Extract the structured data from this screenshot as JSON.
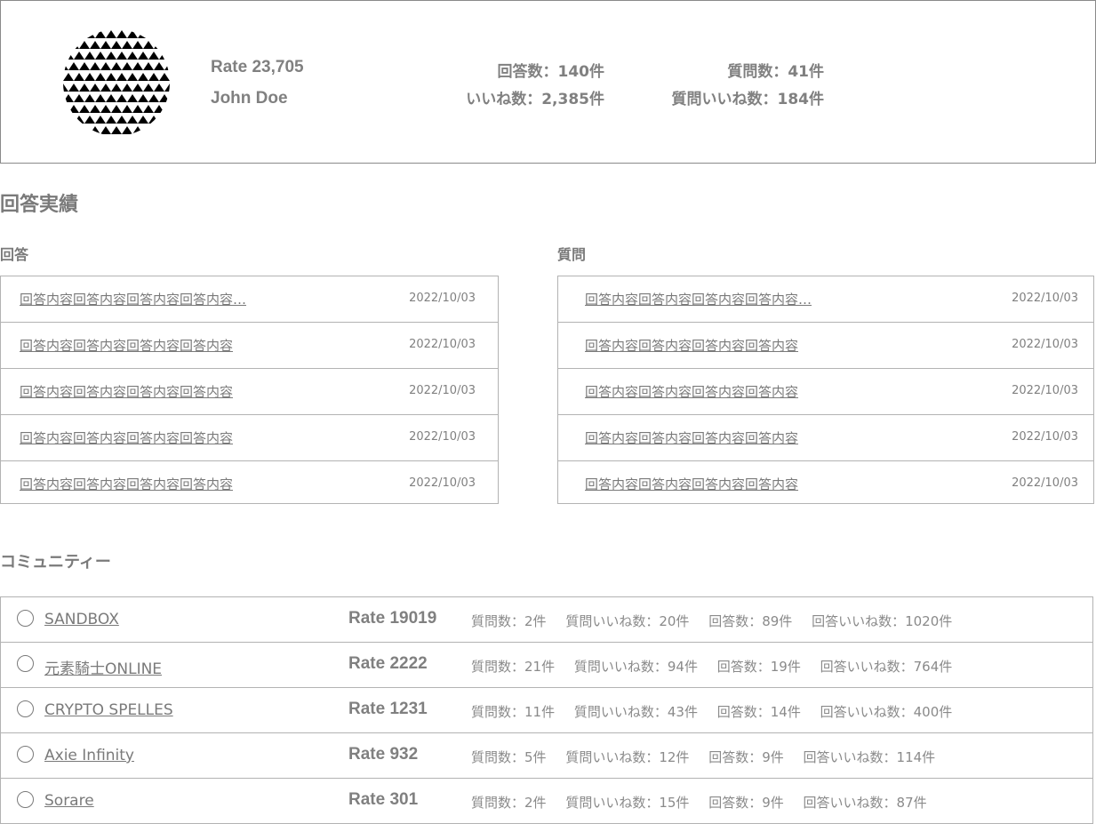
{
  "profile": {
    "rate_label": "Rate 23,705",
    "name": "John Doe",
    "stats": {
      "answer_count": "回答数：140件",
      "question_count": "質問数：41件",
      "like_count": "いいね数：2,385件",
      "question_like_count": "質問いいね数：184件"
    }
  },
  "achievements": {
    "title": "回答実績",
    "answers": {
      "heading": "回答",
      "items": [
        {
          "text": "回答内容回答内容回答内容回答内容…",
          "date": "2022/10/03"
        },
        {
          "text": "回答内容回答内容回答内容回答内容",
          "date": "2022/10/03"
        },
        {
          "text": "回答内容回答内容回答内容回答内容",
          "date": "2022/10/03"
        },
        {
          "text": "回答内容回答内容回答内容回答内容",
          "date": "2022/10/03"
        },
        {
          "text": "回答内容回答内容回答内容回答内容",
          "date": "2022/10/03"
        }
      ]
    },
    "questions": {
      "heading": "質問",
      "items": [
        {
          "text": "回答内容回答内容回答内容回答内容…",
          "date": "2022/10/03"
        },
        {
          "text": "回答内容回答内容回答内容回答内容",
          "date": "2022/10/03"
        },
        {
          "text": "回答内容回答内容回答内容回答内容",
          "date": "2022/10/03"
        },
        {
          "text": "回答内容回答内容回答内容回答内容",
          "date": "2022/10/03"
        },
        {
          "text": "回答内容回答内容回答内容回答内容",
          "date": "2022/10/03"
        }
      ]
    }
  },
  "community": {
    "title": "コミュニティー",
    "items": [
      {
        "name": "SANDBOX",
        "rate": "Rate 19019",
        "questions": "質問数：2件",
        "question_likes": "質問いいね数：20件",
        "answers": "回答数：89件",
        "answer_likes": "回答いいね数：1020件"
      },
      {
        "name": "元素騎士ONLINE",
        "rate": "Rate 2222",
        "questions": "質問数：21件",
        "question_likes": "質問いいね数：94件",
        "answers": "回答数：19件",
        "answer_likes": "回答いいね数：764件"
      },
      {
        "name": "CRYPTO SPELLES",
        "rate": "Rate 1231",
        "questions": "質問数：11件",
        "question_likes": "質問いいね数：43件",
        "answers": "回答数：14件",
        "answer_likes": "回答いいね数：400件"
      },
      {
        "name": "Axie Infinity",
        "rate": "Rate 932",
        "questions": "質問数：5件",
        "question_likes": "質問いいね数：12件",
        "answers": "回答数：9件",
        "answer_likes": "回答いいね数：114件"
      },
      {
        "name": "Sorare",
        "rate": "Rate 301",
        "questions": "質問数：2件",
        "question_likes": "質問いいね数：15件",
        "answers": "回答数：9件",
        "answer_likes": "回答いいね数：87件"
      }
    ]
  },
  "colors": {
    "text": "#777777",
    "border": "#b3b3b3",
    "avatar_pattern": "#000000"
  }
}
